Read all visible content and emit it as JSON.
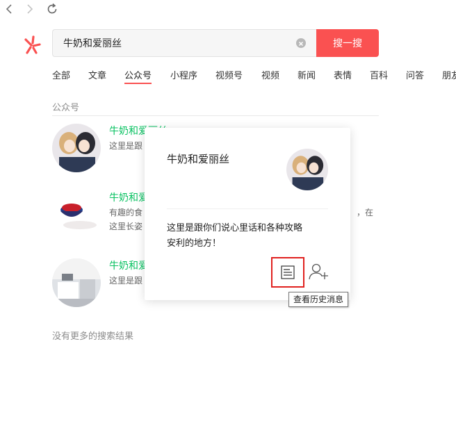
{
  "search": {
    "query": "牛奶和爱丽丝",
    "button_label": "搜一搜"
  },
  "tabs": [
    {
      "label": "全部"
    },
    {
      "label": "文章"
    },
    {
      "label": "公众号",
      "active": true
    },
    {
      "label": "小程序"
    },
    {
      "label": "视频号"
    },
    {
      "label": "视频"
    },
    {
      "label": "新闻"
    },
    {
      "label": "表情"
    },
    {
      "label": "百科"
    },
    {
      "label": "问答"
    },
    {
      "label": "朋友"
    }
  ],
  "section_label": "公众号",
  "results": [
    {
      "title": "牛奶和爱丽丝",
      "desc1": "这里是跟",
      "desc2": ""
    },
    {
      "title": "牛奶和爱",
      "desc1": "有趣的食",
      "desc1_right": "，在",
      "desc2": "这里长姿"
    },
    {
      "title": "牛奶和爱",
      "desc1": "这里是跟",
      "desc2": ""
    }
  ],
  "no_more": "没有更多的搜索结果",
  "popup": {
    "name": "牛奶和爱丽丝",
    "description": "这里是跟你们说心里话和各种攻略安利的地方！",
    "tooltip": "查看历史消息"
  },
  "colors": {
    "accent": "#fa5151",
    "title_green": "#07c160",
    "highlight_border": "#e0201e"
  },
  "icons": [
    "back-icon",
    "forward-icon",
    "refresh-icon",
    "logo-icon",
    "clear-icon",
    "history-articles-icon",
    "add-follow-icon"
  ]
}
